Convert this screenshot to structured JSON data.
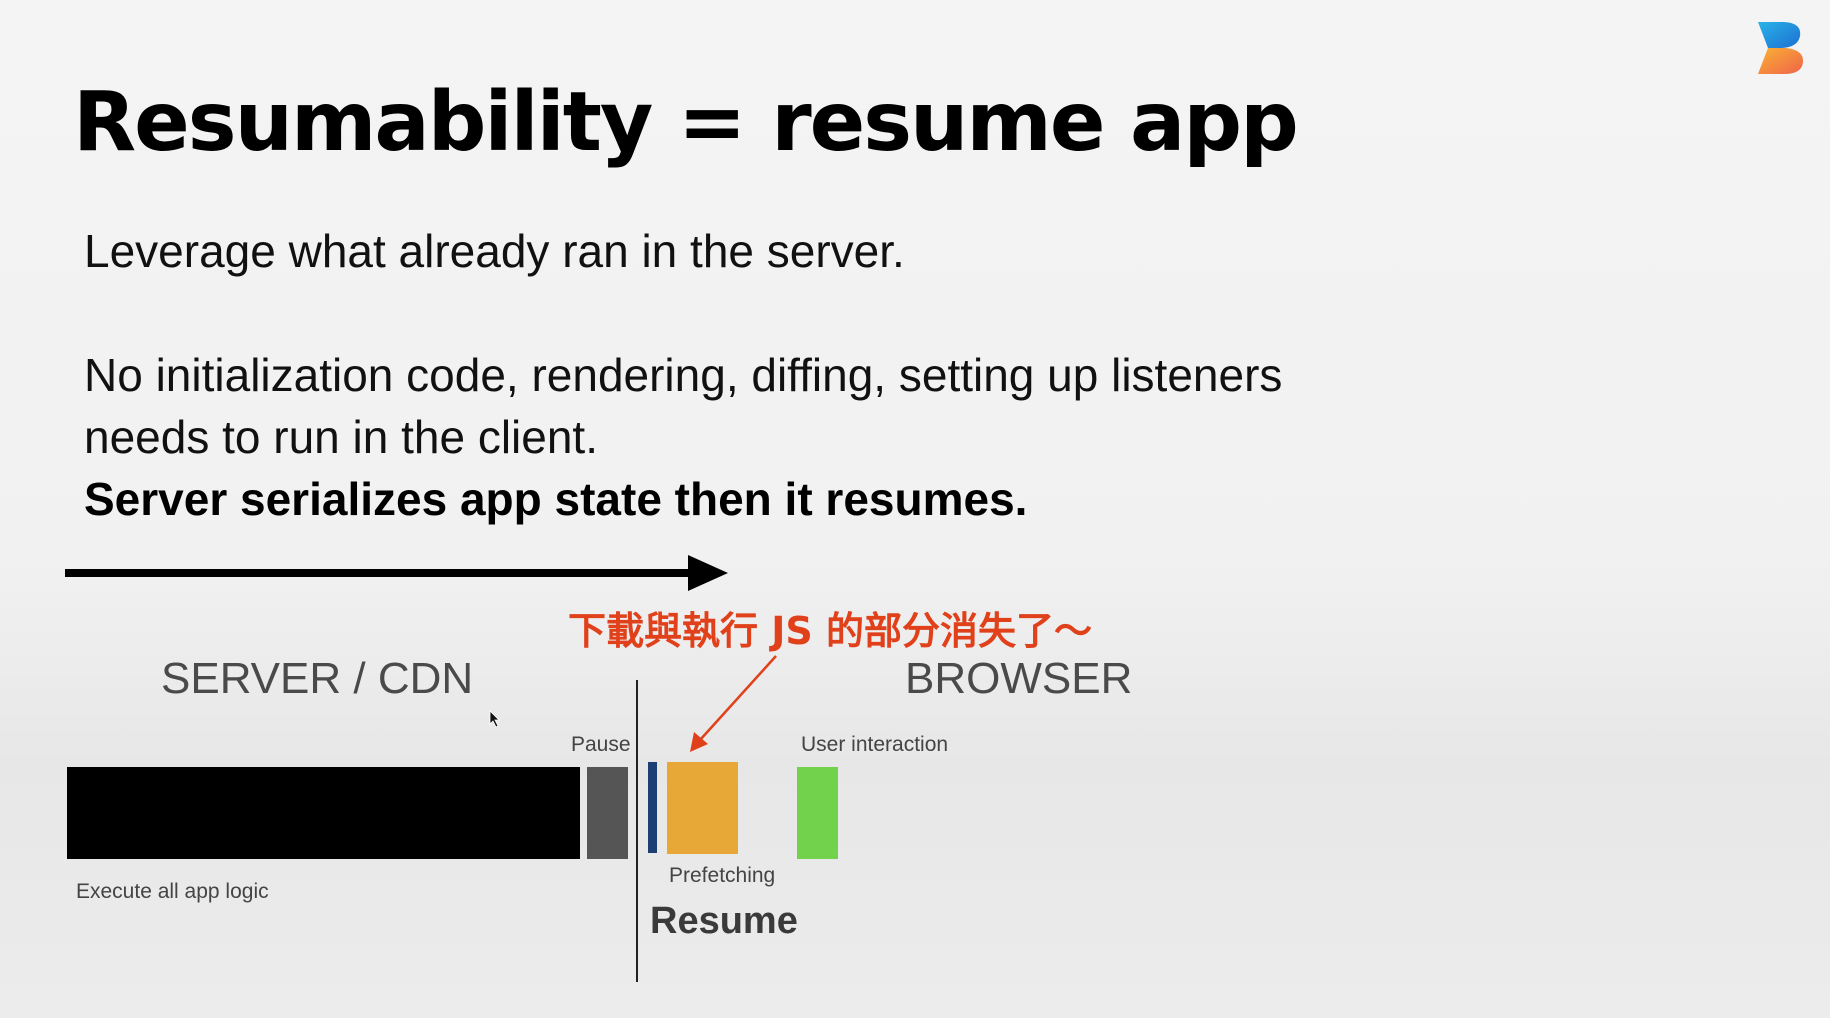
{
  "slide": {
    "title": "Resumability = resume app",
    "paragraphs": [
      "Leverage what already ran in the server.",
      "No initialization code, rendering, diffing, setting up listeners",
      "needs to run in the client."
    ],
    "emphasis": "Server serializes app state then it resumes.",
    "annotation": "下載與執行 JS 的部分消失了～"
  },
  "logo": {
    "icon": "brand-b-logo",
    "colors": [
      "#2bb3e8",
      "#f0634a",
      "#f9b233"
    ]
  },
  "diagram": {
    "server_label": "SERVER / CDN",
    "browser_label": "BROWSER",
    "labels": {
      "pause": "Pause",
      "user_interaction": "User interaction",
      "execute": "Execute all app logic",
      "prefetching": "Prefetching",
      "resume": "Resume"
    },
    "colors": {
      "execute_bar": "#000000",
      "pause_bar": "#555555",
      "resume_marker": "#1e3f73",
      "prefetching_bar": "#e8a838",
      "user_interaction_bar": "#72d24c",
      "annotation": "#e0401a"
    }
  }
}
